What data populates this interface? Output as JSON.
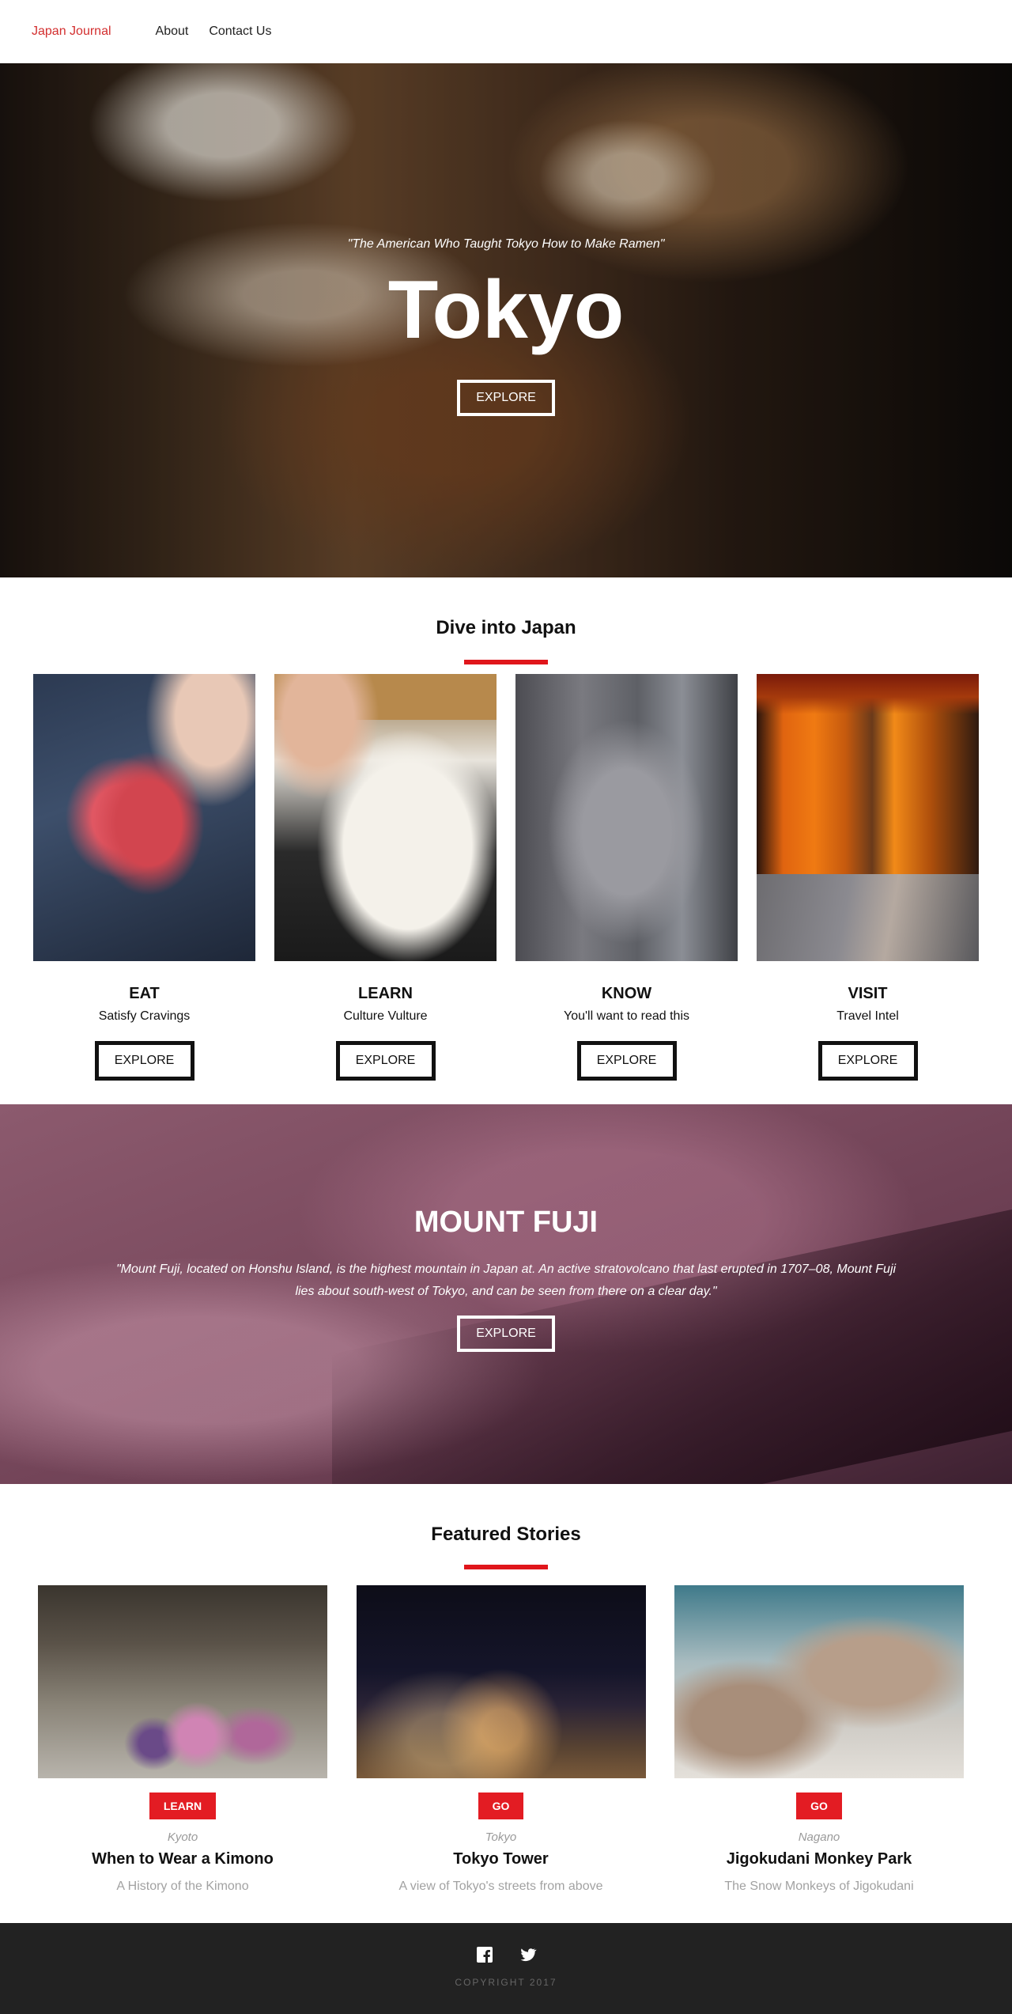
{
  "nav": {
    "brand": "Japan Journal",
    "links": [
      "About",
      "Contact Us"
    ]
  },
  "hero": {
    "quote": "\"The American Who Taught Tokyo How to Make Ramen\"",
    "title": "Tokyo",
    "button": "EXPLORE"
  },
  "dive": {
    "title": "Dive into Japan",
    "cards": [
      {
        "title": "EAT",
        "subtitle": "Satisfy Cravings",
        "button": "EXPLORE"
      },
      {
        "title": "LEARN",
        "subtitle": "Culture Vulture",
        "button": "EXPLORE"
      },
      {
        "title": "KNOW",
        "subtitle": "You'll want to read this",
        "button": "EXPLORE"
      },
      {
        "title": "VISIT",
        "subtitle": "Travel Intel",
        "button": "EXPLORE"
      }
    ]
  },
  "fuji": {
    "title": "MOUNT FUJI",
    "quote": "\"Mount Fuji, located on Honshu Island, is the highest mountain in Japan at. An active stratovolcano that last erupted in 1707–08, Mount Fuji lies about south-west of Tokyo, and can be seen from there on a clear day.\"",
    "button": "EXPLORE"
  },
  "featured": {
    "title": "Featured Stories",
    "stories": [
      {
        "button": "LEARN",
        "location": "Kyoto",
        "title": "When to Wear a Kimono",
        "subtitle": "A History of the Kimono"
      },
      {
        "button": "GO",
        "location": "Tokyo",
        "title": "Tokyo Tower",
        "subtitle": "A view of Tokyo's streets from above"
      },
      {
        "button": "GO",
        "location": "Nagano",
        "title": "Jigokudani Monkey Park",
        "subtitle": "The Snow Monkeys of Jigokudani"
      }
    ]
  },
  "footer": {
    "social": [
      "facebook-icon",
      "twitter-icon"
    ],
    "copyright": "COPYRIGHT 2017"
  },
  "colors": {
    "accent": "#e31c23",
    "brand": "#d32f2f",
    "footer_bg": "#222222"
  }
}
